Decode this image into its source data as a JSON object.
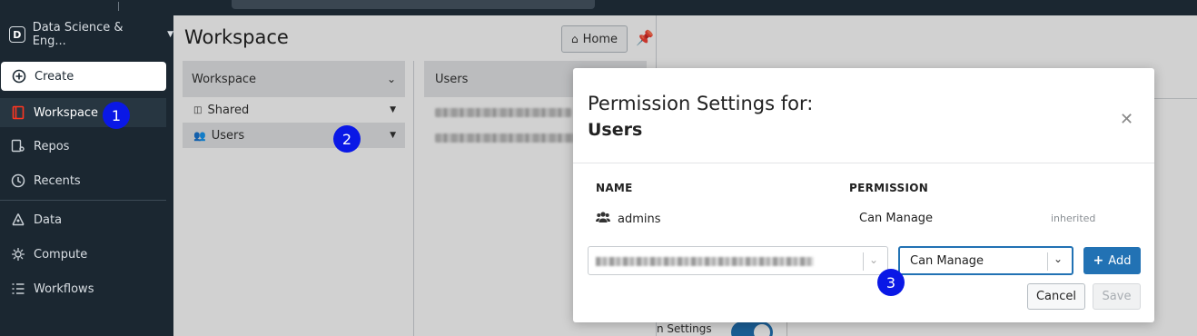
{
  "sidebar": {
    "workspace_name": "Data Science & Eng...",
    "workspace_logo": "D",
    "items": [
      {
        "label": "Create",
        "icon": "plus-circle-icon"
      },
      {
        "label": "Workspace",
        "icon": "workspace-icon"
      },
      {
        "label": "Repos",
        "icon": "repos-icon"
      },
      {
        "label": "Recents",
        "icon": "clock-icon"
      },
      {
        "label": "Data",
        "icon": "data-icon"
      },
      {
        "label": "Compute",
        "icon": "compute-icon"
      },
      {
        "label": "Workflows",
        "icon": "workflows-icon"
      }
    ]
  },
  "main": {
    "title": "Workspace",
    "home_label": "Home",
    "tree_header": "Workspace",
    "tree_items": [
      "Shared",
      "Users"
    ],
    "users_header": "Users",
    "bottom_settings_label": "n Settings"
  },
  "modal": {
    "title_line1": "Permission Settings for:",
    "title_line2": "Users",
    "col_name": "NAME",
    "col_permission": "PERMISSION",
    "rows": [
      {
        "name": "admins",
        "permission": "Can Manage",
        "note": "inherited"
      }
    ],
    "permission_select_value": "Can Manage",
    "add_label": "Add",
    "cancel_label": "Cancel",
    "save_label": "Save"
  },
  "annotations": [
    "1",
    "2",
    "3"
  ],
  "colors": {
    "sidebar_bg": "#1b2731",
    "accent_blue": "#2272b4",
    "badge_blue": "#0a18e6",
    "workspace_icon": "#ff3621"
  }
}
